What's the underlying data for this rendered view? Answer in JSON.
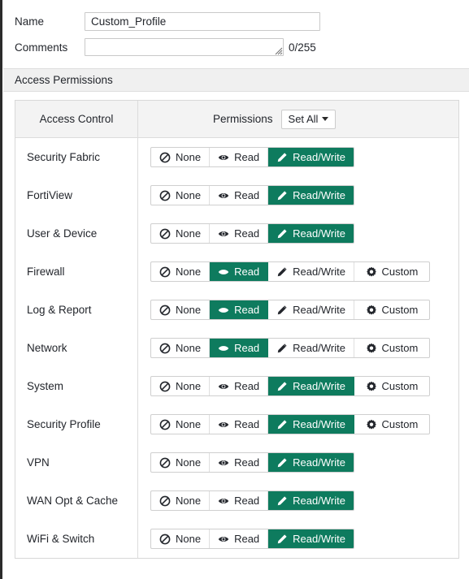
{
  "form": {
    "name_label": "Name",
    "name_value": "Custom_Profile",
    "comments_label": "Comments",
    "comments_value": "",
    "comments_placeholder": "",
    "char_counter": "0/255"
  },
  "section": {
    "title": "Access Permissions"
  },
  "table": {
    "col_access_header": "Access Control",
    "col_perms_header": "Permissions",
    "set_all_label": "Set All",
    "option_labels": {
      "none": "None",
      "read": "Read",
      "readwrite": "Read/Write",
      "custom": "Custom"
    },
    "rows": [
      {
        "label": "Security Fabric",
        "options": [
          "none",
          "read",
          "readwrite"
        ],
        "selected": "readwrite"
      },
      {
        "label": "FortiView",
        "options": [
          "none",
          "read",
          "readwrite"
        ],
        "selected": "readwrite"
      },
      {
        "label": "User & Device",
        "options": [
          "none",
          "read",
          "readwrite"
        ],
        "selected": "readwrite"
      },
      {
        "label": "Firewall",
        "options": [
          "none",
          "read",
          "readwrite",
          "custom"
        ],
        "selected": "read"
      },
      {
        "label": "Log & Report",
        "options": [
          "none",
          "read",
          "readwrite",
          "custom"
        ],
        "selected": "read"
      },
      {
        "label": "Network",
        "options": [
          "none",
          "read",
          "readwrite",
          "custom"
        ],
        "selected": "read"
      },
      {
        "label": "System",
        "options": [
          "none",
          "read",
          "readwrite",
          "custom"
        ],
        "selected": "readwrite"
      },
      {
        "label": "Security Profile",
        "options": [
          "none",
          "read",
          "readwrite",
          "custom"
        ],
        "selected": "readwrite"
      },
      {
        "label": "VPN",
        "options": [
          "none",
          "read",
          "readwrite"
        ],
        "selected": "readwrite"
      },
      {
        "label": "WAN Opt & Cache",
        "options": [
          "none",
          "read",
          "readwrite"
        ],
        "selected": "readwrite"
      },
      {
        "label": "WiFi & Switch",
        "options": [
          "none",
          "read",
          "readwrite"
        ],
        "selected": "readwrite"
      }
    ]
  },
  "icons": {
    "none": "no-entry-icon",
    "read": "eye-icon",
    "readwrite": "pencil-icon",
    "custom": "gear-icon",
    "set_all": "chevron-down-icon",
    "resize": "resize-grip-icon"
  },
  "colors": {
    "accent_green": "#0e7b5e",
    "section_bg": "#f0f0f0",
    "table_header_bg": "#f3f3f3",
    "border": "#d8d8d8",
    "text": "#23262c"
  }
}
